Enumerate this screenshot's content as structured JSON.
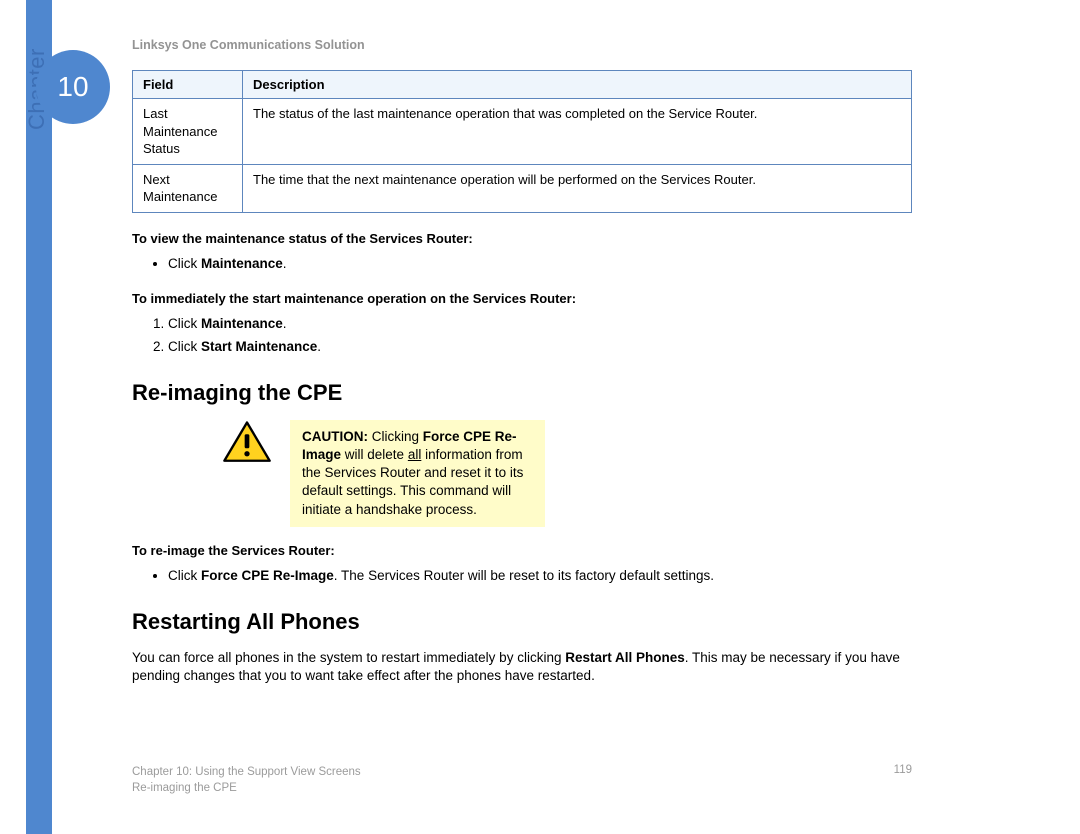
{
  "chapter": {
    "label": "Chapter",
    "number": "10"
  },
  "running_head": "Linksys One Communications Solution",
  "table": {
    "col_field": "Field",
    "col_desc": "Description",
    "rows": [
      {
        "field_l1": "Last",
        "field_l2": "Maintenance",
        "field_l3": "Status",
        "desc": "The status of the last maintenance operation that was completed on the Service Router."
      },
      {
        "field_l1": "Next",
        "field_l2": "Maintenance",
        "field_l3": "",
        "desc": "The time that the next maintenance operation will be performed on the Services Router."
      }
    ]
  },
  "view_lead": "To view the maintenance status of the Services Router:",
  "view_bullet_prefix": "Click ",
  "view_bullet_bold": "Maintenance",
  "view_bullet_suffix": ".",
  "start_lead": "To immediately the start maintenance operation on the Services Router:",
  "start_steps": [
    {
      "prefix": "Click ",
      "bold": "Maintenance",
      "suffix": "."
    },
    {
      "prefix": "Click ",
      "bold": "Start Maintenance",
      "suffix": "."
    }
  ],
  "sec_reimage": "Re-imaging the CPE",
  "caution": {
    "label": "CAUTION:",
    "t1": " Clicking ",
    "bold1": "Force CPE Re-Image",
    "t2": " will delete ",
    "under": "all",
    "t3": " information from the Services Router and reset it to its default settings. This command will initiate a handshake process."
  },
  "reimage_lead": "To re-image the Services Router:",
  "reimage_bullet": {
    "prefix": "Click ",
    "bold": "Force CPE Re-Image",
    "suffix": ". The Services Router will be reset to its factory default settings."
  },
  "sec_restart": "Restarting All Phones",
  "restart_para": {
    "t1": "You can force all phones in the system to restart immediately by clicking ",
    "bold": "Restart All Phones",
    "t2": ". This may be necessary if you have pending changes that you to want take effect after the phones have restarted."
  },
  "footer": {
    "line1": "Chapter 10: Using the Support View Screens",
    "line2": "Re-imaging the CPE",
    "page": "119"
  }
}
